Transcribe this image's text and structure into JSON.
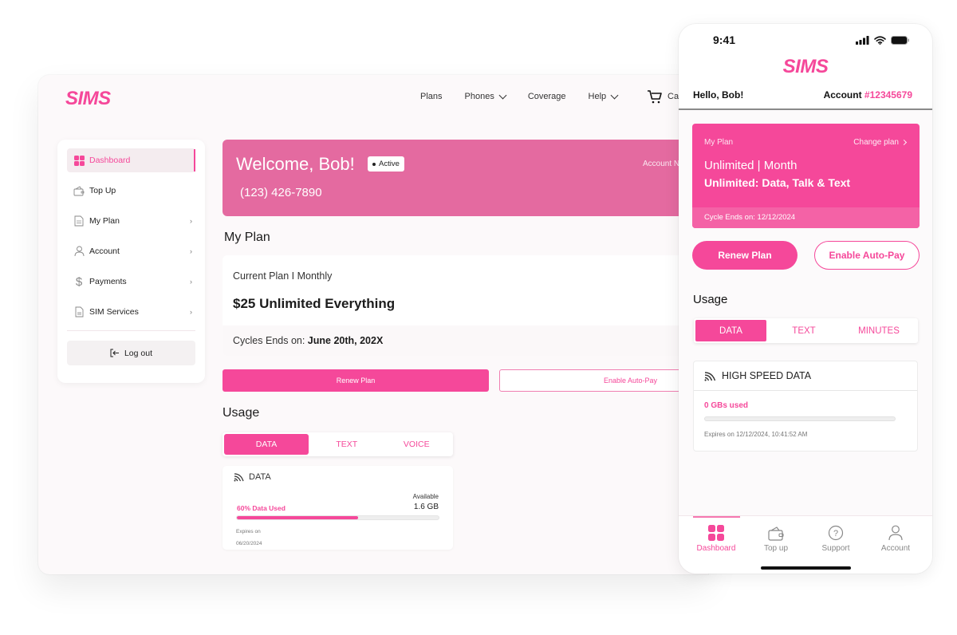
{
  "web": {
    "logo": "SIMS",
    "nav": [
      {
        "label": "Plans",
        "has_dropdown": false
      },
      {
        "label": "Phones",
        "has_dropdown": true
      },
      {
        "label": "Coverage",
        "has_dropdown": false
      },
      {
        "label": "Help",
        "has_dropdown": true
      }
    ],
    "cart_label": "Car",
    "sidebar": {
      "items": [
        {
          "label": "Dashboard",
          "icon": "dashboard-icon",
          "active": true,
          "has_arrow": false
        },
        {
          "label": "Top Up",
          "icon": "wallet-icon",
          "active": false,
          "has_arrow": false
        },
        {
          "label": "My Plan",
          "icon": "document-icon",
          "active": false,
          "has_arrow": true
        },
        {
          "label": "Account",
          "icon": "user-icon",
          "active": false,
          "has_arrow": true
        },
        {
          "label": "Payments",
          "icon": "dollar-icon",
          "active": false,
          "has_arrow": true
        },
        {
          "label": "SIM Services",
          "icon": "sim-card-icon",
          "active": false,
          "has_arrow": true
        }
      ],
      "arrow": "›",
      "logout_label": "Log out"
    },
    "banner": {
      "title": "Welcome, Bob!",
      "status": "Active",
      "phone": "(123) 426-7890",
      "account_label": "Account N"
    },
    "my_plan": {
      "title": "My Plan",
      "subtitle": "Current Plan I Monthly",
      "name": "$25 Unlimited Everything",
      "cycle_label": "Cycles Ends on: ",
      "cycle_date": "June 20th, 202X"
    },
    "buttons": {
      "renew": "Renew Plan",
      "autopay": "Enable Auto-Pay"
    },
    "usage": {
      "title": "Usage",
      "tabs": [
        "DATA",
        "TEXT",
        "VOICE"
      ],
      "active_tab": 0,
      "card_title": "DATA",
      "available_label": "Available",
      "available_value": "1.6 GB",
      "used_label": "60% Data Used",
      "used_percent": 60,
      "expires_label": "Expires on",
      "expires_date": "06/20/2024"
    }
  },
  "phone": {
    "status_time": "9:41",
    "logo": "SIMS",
    "greeting": "Hello, Bob!",
    "account_label": "Account ",
    "account_number": "#12345679",
    "plan": {
      "label": "My Plan",
      "change_label": "Change plan",
      "line1": "Unlimited | Month",
      "line2": "Unlimited: Data, Talk & Text",
      "cycle": "Cycle Ends on: 12/12/2024"
    },
    "buttons": {
      "renew": "Renew Plan",
      "autopay": "Enable Auto-Pay"
    },
    "usage": {
      "title": "Usage",
      "tabs": [
        "DATA",
        "TEXT",
        "MINUTES"
      ],
      "active_tab": 0,
      "card_title": "HIGH SPEED DATA",
      "used_label": "0 GBs used",
      "used_percent": 0,
      "expires": "Expires on 12/12/2024, 10:41:52 AM"
    },
    "tabbar": [
      {
        "label": "Dashboard",
        "icon": "dashboard-icon",
        "active": true
      },
      {
        "label": "Top up",
        "icon": "wallet-icon",
        "active": false
      },
      {
        "label": "Support",
        "icon": "help-circle-icon",
        "active": false
      },
      {
        "label": "Account",
        "icon": "user-icon",
        "active": false
      }
    ]
  },
  "colors": {
    "brand": "#f5489a",
    "banner": "#e46aa0",
    "background": "#fcf9fa"
  }
}
